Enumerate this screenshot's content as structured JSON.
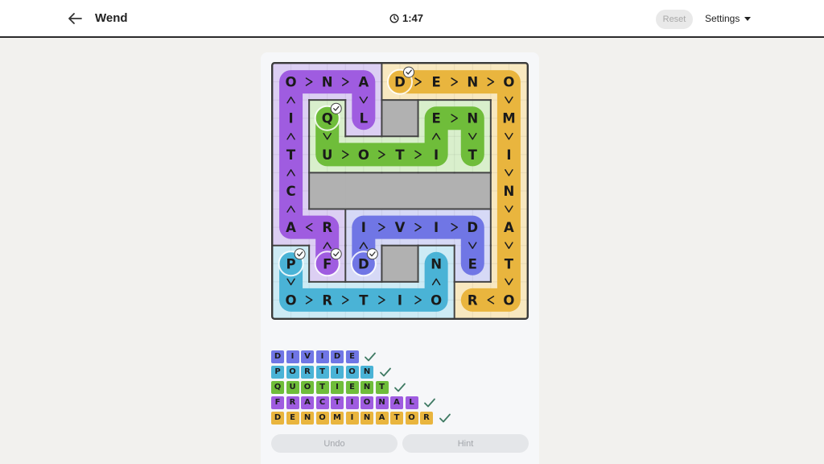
{
  "header": {
    "title": "Wend",
    "timer": "1:47",
    "reset_label": "Reset",
    "settings_label": "Settings"
  },
  "colors": {
    "divide": "#7076e5",
    "portion": "#4ab3d6",
    "quotient": "#6fbd3a",
    "fractional": "#9f5ce0",
    "denominator": "#e9b53e"
  },
  "board": {
    "rows": 7,
    "cols": 7,
    "regions": [
      {
        "name": "fractional-region",
        "fill": "#dccff3",
        "cells": [
          [
            0,
            0
          ],
          [
            0,
            1
          ],
          [
            0,
            2
          ],
          [
            1,
            0
          ],
          [
            2,
            0
          ],
          [
            3,
            0
          ],
          [
            4,
            0
          ],
          [
            4,
            1
          ],
          [
            5,
            1
          ],
          [
            1,
            2
          ]
        ]
      },
      {
        "name": "denominator-region",
        "fill": "#f8e8c0",
        "cells": [
          [
            0,
            3
          ],
          [
            0,
            4
          ],
          [
            0,
            5
          ],
          [
            0,
            6
          ],
          [
            1,
            6
          ],
          [
            2,
            6
          ],
          [
            3,
            6
          ],
          [
            4,
            6
          ],
          [
            5,
            6
          ],
          [
            6,
            6
          ],
          [
            6,
            5
          ]
        ]
      },
      {
        "name": "quotient-region",
        "fill": "#d9efcc",
        "cells": [
          [
            1,
            1
          ],
          [
            2,
            1
          ],
          [
            2,
            2
          ],
          [
            2,
            3
          ],
          [
            2,
            4
          ],
          [
            2,
            5
          ],
          [
            1,
            4
          ],
          [
            1,
            5
          ]
        ]
      },
      {
        "name": "divide-region",
        "fill": "#d6d9f6",
        "cells": [
          [
            4,
            2
          ],
          [
            4,
            3
          ],
          [
            4,
            4
          ],
          [
            4,
            5
          ],
          [
            5,
            2
          ],
          [
            5,
            5
          ]
        ]
      },
      {
        "name": "portion-region",
        "fill": "#cdebf5",
        "cells": [
          [
            5,
            0
          ],
          [
            6,
            0
          ],
          [
            6,
            1
          ],
          [
            6,
            2
          ],
          [
            6,
            3
          ],
          [
            6,
            4
          ],
          [
            5,
            4
          ]
        ]
      }
    ],
    "blocked": [
      [
        1,
        3
      ],
      [
        3,
        1
      ],
      [
        3,
        2
      ],
      [
        3,
        3
      ],
      [
        3,
        4
      ],
      [
        3,
        5
      ],
      [
        5,
        3
      ]
    ],
    "letters": [
      [
        "O",
        "N",
        "A",
        "D",
        "E",
        "N",
        "O"
      ],
      [
        "I",
        "Q",
        "L",
        "",
        "E",
        "N",
        "M"
      ],
      [
        "T",
        "U",
        "O",
        "T",
        "I",
        "T",
        "I"
      ],
      [
        "C",
        "",
        "",
        "",
        "",
        "",
        "N"
      ],
      [
        "A",
        "R",
        "I",
        "V",
        "I",
        "D",
        "A"
      ],
      [
        "P",
        "F",
        "D",
        "",
        "N",
        "E",
        "T"
      ],
      [
        "O",
        "R",
        "T",
        "I",
        "O",
        "R",
        "O"
      ]
    ],
    "paths": [
      {
        "word": "FRACTIONAL",
        "color": "#9f5ce0",
        "cells": [
          [
            5,
            1
          ],
          [
            4,
            1
          ],
          [
            4,
            0
          ],
          [
            3,
            0
          ],
          [
            2,
            0
          ],
          [
            1,
            0
          ],
          [
            0,
            0
          ],
          [
            0,
            1
          ],
          [
            0,
            2
          ],
          [
            1,
            2
          ]
        ]
      },
      {
        "word": "DENOMINATOR",
        "color": "#e9b53e",
        "cells": [
          [
            0,
            3
          ],
          [
            0,
            4
          ],
          [
            0,
            5
          ],
          [
            0,
            6
          ],
          [
            1,
            6
          ],
          [
            2,
            6
          ],
          [
            3,
            6
          ],
          [
            4,
            6
          ],
          [
            5,
            6
          ],
          [
            6,
            6
          ],
          [
            6,
            5
          ]
        ]
      },
      {
        "word": "QUOTIENT",
        "color": "#6fbd3a",
        "cells": [
          [
            1,
            1
          ],
          [
            2,
            1
          ],
          [
            2,
            2
          ],
          [
            2,
            3
          ],
          [
            2,
            4
          ],
          [
            1,
            4
          ],
          [
            1,
            5
          ],
          [
            2,
            5
          ]
        ]
      },
      {
        "word": "DIVIDE",
        "color": "#7076e5",
        "cells": [
          [
            5,
            2
          ],
          [
            4,
            2
          ],
          [
            4,
            3
          ],
          [
            4,
            4
          ],
          [
            4,
            5
          ],
          [
            5,
            5
          ]
        ]
      },
      {
        "word": "PORTION",
        "color": "#4ab3d6",
        "cells": [
          [
            5,
            0
          ],
          [
            6,
            0
          ],
          [
            6,
            1
          ],
          [
            6,
            2
          ],
          [
            6,
            3
          ],
          [
            6,
            4
          ],
          [
            5,
            4
          ]
        ]
      }
    ]
  },
  "words": [
    {
      "name": "divide",
      "letters": [
        "D",
        "I",
        "V",
        "I",
        "D",
        "E"
      ],
      "color": "#7076e5"
    },
    {
      "name": "portion",
      "letters": [
        "P",
        "O",
        "R",
        "T",
        "I",
        "O",
        "N"
      ],
      "color": "#4ab3d6"
    },
    {
      "name": "quotient",
      "letters": [
        "Q",
        "U",
        "O",
        "T",
        "I",
        "E",
        "N",
        "T"
      ],
      "color": "#6fbd3a"
    },
    {
      "name": "fractional",
      "letters": [
        "F",
        "R",
        "A",
        "C",
        "T",
        "I",
        "O",
        "N",
        "A",
        "L"
      ],
      "color": "#9f5ce0"
    },
    {
      "name": "denominator",
      "letters": [
        "D",
        "E",
        "N",
        "O",
        "M",
        "I",
        "N",
        "A",
        "T",
        "O",
        "R"
      ],
      "color": "#e9b53e"
    }
  ],
  "actions": {
    "undo_label": "Undo",
    "hint_label": "Hint"
  }
}
